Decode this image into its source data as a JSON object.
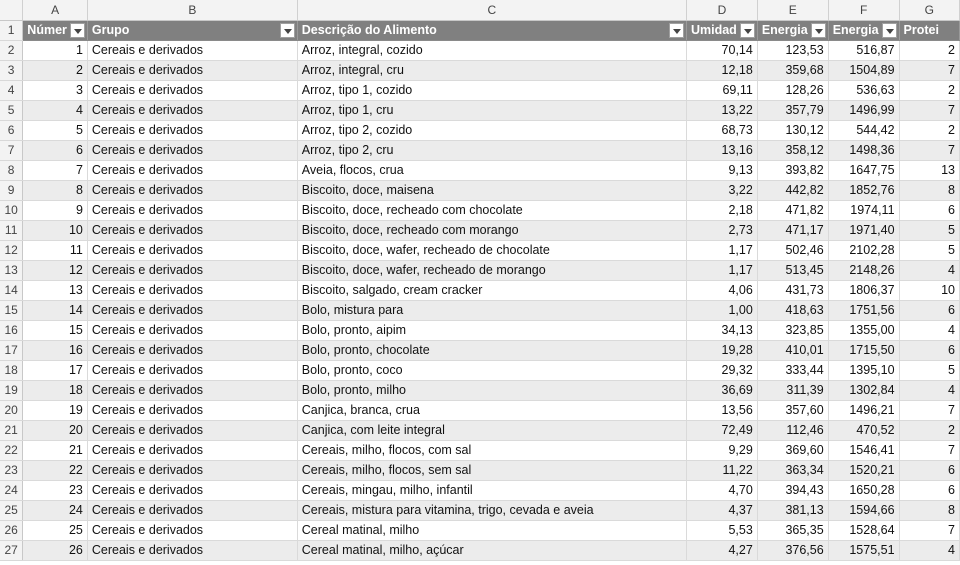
{
  "columns": [
    "A",
    "B",
    "C",
    "D",
    "E",
    "F",
    "G"
  ],
  "headers": [
    "Númer",
    "Grupo",
    "Descrição do Alimento",
    "Umidad",
    "Energia",
    "Energia",
    "Protei"
  ],
  "rows": [
    {
      "n": "2",
      "id": "1",
      "grupo": "Cereais e derivados",
      "desc": "Arroz, integral, cozido",
      "umid": "70,14",
      "kcal": "123,53",
      "kj": "516,87",
      "prot": "2"
    },
    {
      "n": "3",
      "id": "2",
      "grupo": "Cereais e derivados",
      "desc": "Arroz, integral, cru",
      "umid": "12,18",
      "kcal": "359,68",
      "kj": "1504,89",
      "prot": "7"
    },
    {
      "n": "4",
      "id": "3",
      "grupo": "Cereais e derivados",
      "desc": "Arroz, tipo 1, cozido",
      "umid": "69,11",
      "kcal": "128,26",
      "kj": "536,63",
      "prot": "2"
    },
    {
      "n": "5",
      "id": "4",
      "grupo": "Cereais e derivados",
      "desc": "Arroz, tipo 1, cru",
      "umid": "13,22",
      "kcal": "357,79",
      "kj": "1496,99",
      "prot": "7"
    },
    {
      "n": "6",
      "id": "5",
      "grupo": "Cereais e derivados",
      "desc": "Arroz, tipo 2, cozido",
      "umid": "68,73",
      "kcal": "130,12",
      "kj": "544,42",
      "prot": "2"
    },
    {
      "n": "7",
      "id": "6",
      "grupo": "Cereais e derivados",
      "desc": "Arroz, tipo 2, cru",
      "umid": "13,16",
      "kcal": "358,12",
      "kj": "1498,36",
      "prot": "7"
    },
    {
      "n": "8",
      "id": "7",
      "grupo": "Cereais e derivados",
      "desc": "Aveia, flocos, crua",
      "umid": "9,13",
      "kcal": "393,82",
      "kj": "1647,75",
      "prot": "13"
    },
    {
      "n": "9",
      "id": "8",
      "grupo": "Cereais e derivados",
      "desc": "Biscoito, doce, maisena",
      "umid": "3,22",
      "kcal": "442,82",
      "kj": "1852,76",
      "prot": "8"
    },
    {
      "n": "10",
      "id": "9",
      "grupo": "Cereais e derivados",
      "desc": "Biscoito, doce, recheado com chocolate",
      "umid": "2,18",
      "kcal": "471,82",
      "kj": "1974,11",
      "prot": "6"
    },
    {
      "n": "11",
      "id": "10",
      "grupo": "Cereais e derivados",
      "desc": "Biscoito, doce, recheado com morango",
      "umid": "2,73",
      "kcal": "471,17",
      "kj": "1971,40",
      "prot": "5"
    },
    {
      "n": "12",
      "id": "11",
      "grupo": "Cereais e derivados",
      "desc": "Biscoito, doce, wafer, recheado de chocolate",
      "umid": "1,17",
      "kcal": "502,46",
      "kj": "2102,28",
      "prot": "5"
    },
    {
      "n": "13",
      "id": "12",
      "grupo": "Cereais e derivados",
      "desc": "Biscoito, doce, wafer, recheado de morango",
      "umid": "1,17",
      "kcal": "513,45",
      "kj": "2148,26",
      "prot": "4"
    },
    {
      "n": "14",
      "id": "13",
      "grupo": "Cereais e derivados",
      "desc": "Biscoito, salgado, cream cracker",
      "umid": "4,06",
      "kcal": "431,73",
      "kj": "1806,37",
      "prot": "10"
    },
    {
      "n": "15",
      "id": "14",
      "grupo": "Cereais e derivados",
      "desc": "Bolo, mistura para",
      "umid": "1,00",
      "kcal": "418,63",
      "kj": "1751,56",
      "prot": "6"
    },
    {
      "n": "16",
      "id": "15",
      "grupo": "Cereais e derivados",
      "desc": "Bolo, pronto, aipim",
      "umid": "34,13",
      "kcal": "323,85",
      "kj": "1355,00",
      "prot": "4"
    },
    {
      "n": "17",
      "id": "16",
      "grupo": "Cereais e derivados",
      "desc": "Bolo, pronto, chocolate",
      "umid": "19,28",
      "kcal": "410,01",
      "kj": "1715,50",
      "prot": "6"
    },
    {
      "n": "18",
      "id": "17",
      "grupo": "Cereais e derivados",
      "desc": "Bolo, pronto, coco",
      "umid": "29,32",
      "kcal": "333,44",
      "kj": "1395,10",
      "prot": "5"
    },
    {
      "n": "19",
      "id": "18",
      "grupo": "Cereais e derivados",
      "desc": "Bolo, pronto, milho",
      "umid": "36,69",
      "kcal": "311,39",
      "kj": "1302,84",
      "prot": "4"
    },
    {
      "n": "20",
      "id": "19",
      "grupo": "Cereais e derivados",
      "desc": "Canjica, branca, crua",
      "umid": "13,56",
      "kcal": "357,60",
      "kj": "1496,21",
      "prot": "7"
    },
    {
      "n": "21",
      "id": "20",
      "grupo": "Cereais e derivados",
      "desc": "Canjica, com leite integral",
      "umid": "72,49",
      "kcal": "112,46",
      "kj": "470,52",
      "prot": "2"
    },
    {
      "n": "22",
      "id": "21",
      "grupo": "Cereais e derivados",
      "desc": "Cereais, milho, flocos, com sal",
      "umid": "9,29",
      "kcal": "369,60",
      "kj": "1546,41",
      "prot": "7"
    },
    {
      "n": "23",
      "id": "22",
      "grupo": "Cereais e derivados",
      "desc": "Cereais, milho, flocos, sem sal",
      "umid": "11,22",
      "kcal": "363,34",
      "kj": "1520,21",
      "prot": "6"
    },
    {
      "n": "24",
      "id": "23",
      "grupo": "Cereais e derivados",
      "desc": "Cereais, mingau, milho, infantil",
      "umid": "4,70",
      "kcal": "394,43",
      "kj": "1650,28",
      "prot": "6"
    },
    {
      "n": "25",
      "id": "24",
      "grupo": "Cereais e derivados",
      "desc": "Cereais, mistura para vitamina, trigo, cevada e aveia",
      "umid": "4,37",
      "kcal": "381,13",
      "kj": "1594,66",
      "prot": "8"
    },
    {
      "n": "26",
      "id": "25",
      "grupo": "Cereais e derivados",
      "desc": "Cereal matinal, milho",
      "umid": "5,53",
      "kcal": "365,35",
      "kj": "1528,64",
      "prot": "7"
    },
    {
      "n": "27",
      "id": "26",
      "grupo": "Cereais e derivados",
      "desc": "Cereal matinal, milho, açúcar",
      "umid": "4,27",
      "kcal": "376,56",
      "kj": "1575,51",
      "prot": "4"
    }
  ],
  "colors": {
    "header_bg": "#808080",
    "band_bg": "#ececec",
    "chrome_bg": "#f3f3f3"
  }
}
